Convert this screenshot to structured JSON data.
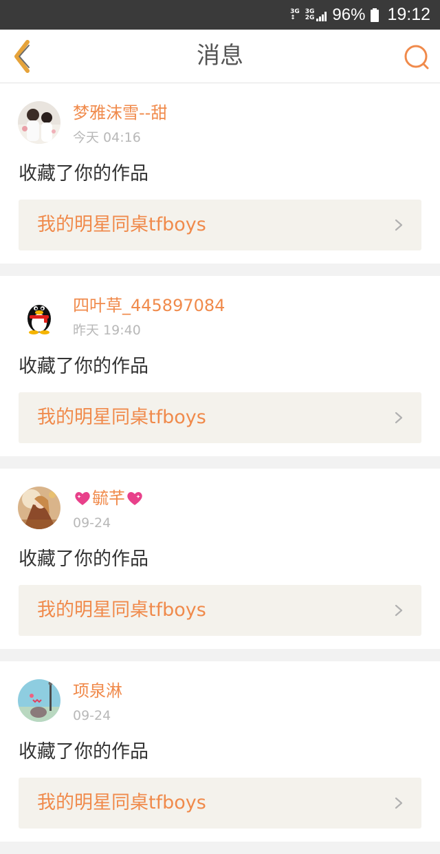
{
  "status_bar": {
    "net1": [
      "3G",
      "↕"
    ],
    "net2": [
      "3G",
      "2G"
    ],
    "battery": "96%",
    "time": "19:12"
  },
  "header": {
    "title": "消息",
    "back_icon": "chevron-left-icon",
    "search_icon": "search-icon"
  },
  "messages": [
    {
      "username": "梦雅沫雪--甜",
      "time": "今天 04:16",
      "action": "收藏了你的作品",
      "work": "我的明星同桌tfboys",
      "avatar": "photo-couple"
    },
    {
      "username": "四叶草_445897084",
      "time": "昨天 19:40",
      "action": "收藏了你的作品",
      "work": "我的明星同桌tfboys",
      "avatar": "qq-penguin"
    },
    {
      "username": "毓芊",
      "username_decoration": "heart-emoji",
      "time": "09-24",
      "action": "收藏了你的作品",
      "work": "我的明星同桌tfboys",
      "avatar": "photo-illustration"
    },
    {
      "username": "项泉淋",
      "time": "09-24",
      "action": "收藏了你的作品",
      "work": "我的明星同桌tfboys",
      "avatar": "photo-sky"
    }
  ],
  "colors": {
    "accent": "#f08a4b",
    "status_bar": "#3a3a3a",
    "link_bg": "#f4f2ec",
    "heart": "#e8408a"
  }
}
